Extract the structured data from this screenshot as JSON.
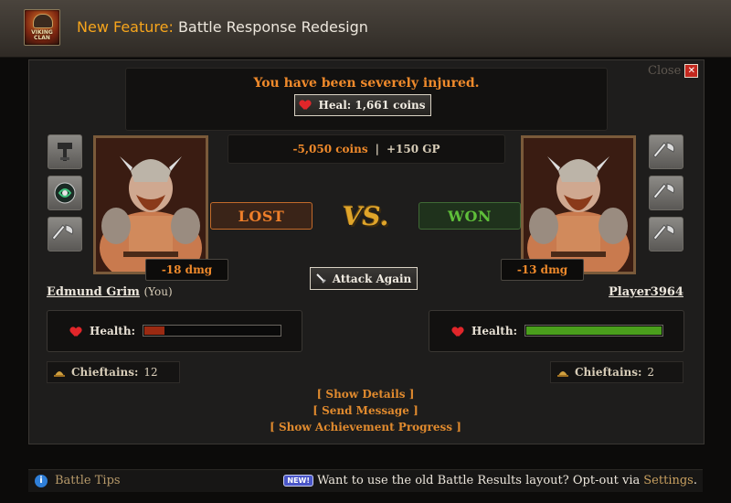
{
  "header": {
    "logo_text": "VIKING CLAN",
    "title_accent": "New Feature:",
    "title_rest": "Battle Response Redesign"
  },
  "dialog": {
    "close_label": "Close",
    "close_glyph": "✕",
    "injury_message": "You have been severely injured.",
    "heal_label": "Heal: 1,661 coins",
    "loot_coins": "-5,050 coins",
    "loot_separator": "|",
    "loot_gp": "+150 GP",
    "vs_label": "VS.",
    "attack_again_label": "Attack Again"
  },
  "player": {
    "name": "Edmund Grim",
    "suffix": "(You)",
    "result": "LOST",
    "damage": "-18 dmg",
    "health_label": "Health:",
    "health_fraction": 0.15,
    "health_color": "#9a2a12",
    "chieftains_label": "Chieftains:",
    "chieftains_value": "12",
    "equipment_icons": [
      "hammer-icon",
      "rune-shield-icon",
      "axe-icon"
    ]
  },
  "opponent": {
    "name": "Player3964",
    "result": "WON",
    "damage": "-13 dmg",
    "health_label": "Health:",
    "health_fraction": 1.0,
    "health_color": "#4a9e1c",
    "chieftains_label": "Chieftains:",
    "chieftains_value": "2",
    "equipment_icons": [
      "axe-icon",
      "axe-icon",
      "axe-icon"
    ]
  },
  "links": {
    "show_details": "[ Show Details ]",
    "send_message": "[ Send Message ]",
    "show_achievement": "[ Show Achievement Progress ]"
  },
  "footer": {
    "info_glyph": "i",
    "tips_label": "Battle Tips",
    "new_badge": "NEW!",
    "optout_text": "Want to use the old Battle Results layout? Opt-out via",
    "settings_label": "Settings",
    "period": "."
  },
  "colors": {
    "accent_orange": "#f08a2b",
    "header_accent": "#f7a51c",
    "won_green": "#5fbf3a",
    "lost_orange": "#ef7f2a"
  }
}
